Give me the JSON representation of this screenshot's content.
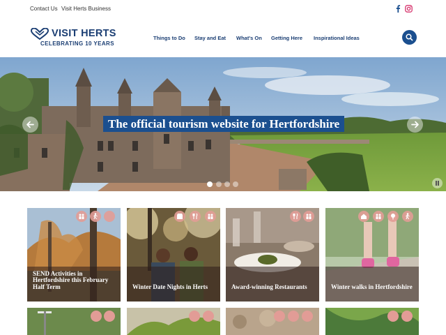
{
  "utility": {
    "contact": "Contact Us",
    "business": "Visit Herts Business"
  },
  "logo": {
    "title": "VISIT HERTS",
    "subtitle": "CELEBRATING 10 YEARS"
  },
  "nav": {
    "items": [
      {
        "label": "Things to Do"
      },
      {
        "label": "Stay and Eat"
      },
      {
        "label": "What's On"
      },
      {
        "label": "Getting Here"
      },
      {
        "label": "Inspirational Ideas"
      }
    ]
  },
  "hero": {
    "title": "The official tourism website for Hertfordshire",
    "slide_count": 4,
    "active_slide": 1
  },
  "cards": [
    {
      "title": "SEND Activities in Hertfordshire this February Half Term",
      "icons": [
        "family-icon",
        "walking-icon",
        "blank-icon"
      ]
    },
    {
      "title": "Winter Date Nights in Herts",
      "icons": [
        "shop-icon",
        "food-icon",
        "family-icon"
      ]
    },
    {
      "title": "Award-winning Restaurants",
      "icons": [
        "food-icon",
        "family-icon"
      ]
    },
    {
      "title": "Winter walks in Hertfordshire",
      "icons": [
        "home-icon",
        "family-icon",
        "nature-icon",
        "walking-icon"
      ]
    }
  ],
  "colors": {
    "brand_navy": "#1b3e73",
    "brand_blue": "#1b4f8f",
    "icon_pink": "#e29c96"
  }
}
